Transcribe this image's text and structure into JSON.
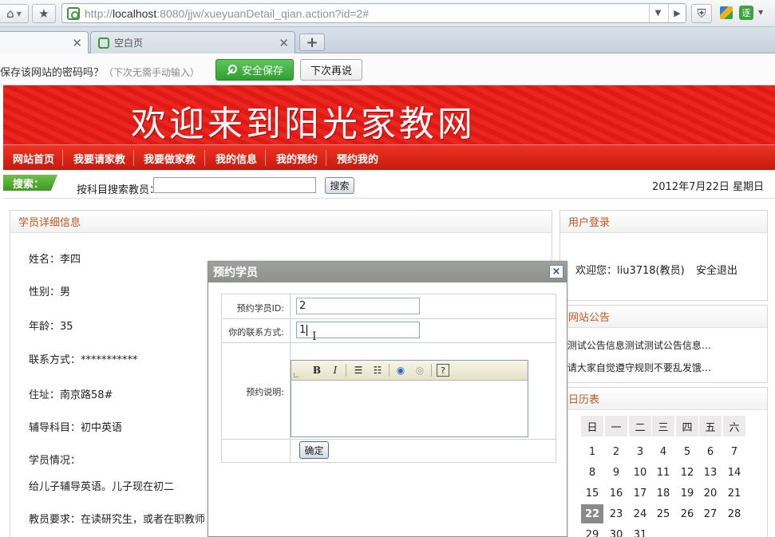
{
  "browser": {
    "url_prefix": "http://",
    "url_host": "localhost",
    "url_rest": ":8080/jjw/xueyuanDetail_qian.action?id=2#",
    "tabs": [
      {
        "label": ""
      },
      {
        "label": "空白页"
      }
    ],
    "extension_label": "逐"
  },
  "password_bar": {
    "question": "保存该网站的密码吗？",
    "hint": "（下次无需手动输入）",
    "save_label": "安全保存",
    "later_label": "下次再说"
  },
  "site": {
    "banner_title": "欢迎来到阳光家教网",
    "menu": [
      "网站首页",
      "我要请家教",
      "我要做家教",
      "我的信息",
      "我的预约",
      "预约我的"
    ],
    "search": {
      "label": "搜索：",
      "by_label": "按科目搜索教员：",
      "input_value": "",
      "button_label": "搜索"
    },
    "date": "2012年7月22日 星期日"
  },
  "student_panel": {
    "title": "学员详细信息",
    "fields": [
      "姓名：李四",
      "性别：男",
      "年龄：35",
      "联系方式：***********",
      "住址：南京路58#",
      "辅导科目：初中英语",
      "学员情况：",
      "给儿子辅导英语。儿子现在初二",
      "教员要求：在读研究生，或者在职教师"
    ]
  },
  "login_panel": {
    "title": "用户登录",
    "welcome": "欢迎您：liu3718(教员)",
    "logout": "安全退出"
  },
  "notice_panel": {
    "title": "网站公告",
    "items": [
      "·测试公告信息测试测试公告信息…",
      "·请大家自觉遵守规则不要乱发饿…"
    ]
  },
  "calendar": {
    "title": "日历表",
    "weekdays": [
      "日",
      "一",
      "二",
      "三",
      "四",
      "五",
      "六"
    ],
    "weeks": [
      [
        "1",
        "2",
        "3",
        "4",
        "5",
        "6",
        "7"
      ],
      [
        "8",
        "9",
        "10",
        "11",
        "12",
        "13",
        "14"
      ],
      [
        "15",
        "16",
        "17",
        "18",
        "19",
        "20",
        "21"
      ],
      [
        "22",
        "23",
        "24",
        "25",
        "26",
        "27",
        "28"
      ],
      [
        "29",
        "30",
        "31",
        "",
        "",
        "",
        ""
      ]
    ],
    "today": "22"
  },
  "dialog": {
    "title": "预约学员",
    "close": "×",
    "student_id_label": "预约学员ID:",
    "student_id_value": "2",
    "contact_label": "你的联系方式:",
    "contact_value": "1",
    "note_label": "预约说明:",
    "submit_label": "确定"
  },
  "colors": {
    "banner_red": "#e81a14",
    "menu_red": "#d8230f",
    "panel_title": "#c8541c",
    "search_green": "#4fa82e",
    "save_green": "#3fae3f"
  }
}
